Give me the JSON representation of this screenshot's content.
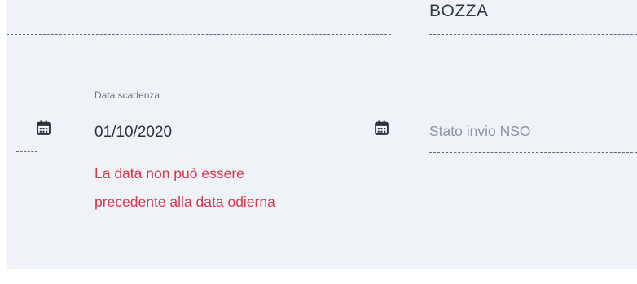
{
  "top_field": {
    "value": "BOZZA"
  },
  "due_date_field": {
    "label": "Data scadenza",
    "value": "01/10/2020",
    "error_line1": "La data non può essere",
    "error_line2": "precedente alla data odierna"
  },
  "nso_field": {
    "label": "Stato invio NSO"
  },
  "colors": {
    "panel_bg": "#eff3f7",
    "error": "#d9364f",
    "text": "#2a333c",
    "muted": "#8a949d"
  },
  "icons": [
    "calendar-icon"
  ]
}
